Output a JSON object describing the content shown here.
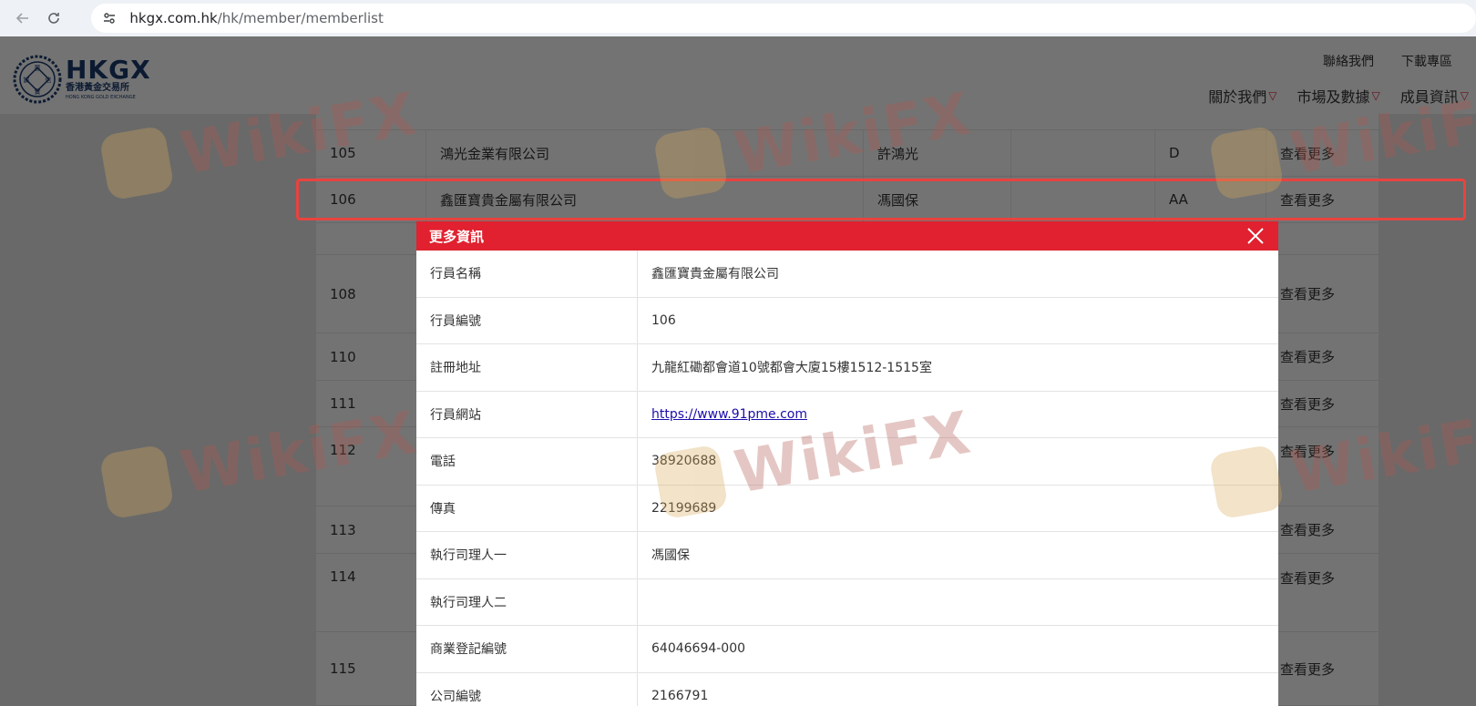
{
  "browser": {
    "url_host": "hkgx.com.hk",
    "url_path": "/hk/member/memberlist"
  },
  "site": {
    "logo_main": "HKGX",
    "logo_cn": "香港黃金交易所",
    "logo_en": "HONG KONG GOLD EXCHANGE",
    "seal_top": "蕙",
    "seal_left": "誠",
    "seal_right": "信",
    "seal_bottom": "實",
    "util_links": [
      "聯絡我們",
      "下載專區"
    ],
    "nav": [
      "關於我們",
      "市場及數據",
      "成員資訊"
    ]
  },
  "table": {
    "rows": [
      {
        "no": "105",
        "name": "鴻光金業有限公司",
        "rep": "許鴻光",
        "cat": "D",
        "more": "查看更多"
      },
      {
        "no": "106",
        "name": "鑫匯寶貴金屬有限公司",
        "rep": "馮國保",
        "cat": "AA",
        "more": "查看更多"
      },
      {
        "no": "108",
        "more": "查看更多"
      },
      {
        "no": "110",
        "more": "查看更多"
      },
      {
        "no": "111",
        "more": "查看更多"
      },
      {
        "no": "112",
        "more": "查看更多"
      },
      {
        "no": "113",
        "more": "查看更多"
      },
      {
        "no": "114",
        "more": "查看更多"
      },
      {
        "no": "115",
        "more": "查看更多"
      }
    ]
  },
  "modal": {
    "title": "更多資訊",
    "rows": [
      {
        "label": "行員名稱",
        "value": "鑫匯寶貴金屬有限公司"
      },
      {
        "label": "行員編號",
        "value": "106"
      },
      {
        "label": "註冊地址",
        "value": "九龍紅磡都會道10號都會大廈15樓1512-1515室"
      },
      {
        "label": "行員網站",
        "value": "https://www.91pme.com"
      },
      {
        "label": "電話",
        "value": "38920688"
      },
      {
        "label": "傳真",
        "value": "22199689"
      },
      {
        "label": "執行司理人一",
        "value": "馮國保"
      },
      {
        "label": "執行司理人二",
        "value": ""
      },
      {
        "label": "商業登記編號",
        "value": "64046694-000"
      },
      {
        "label": "公司編號",
        "value": "2166791"
      }
    ]
  },
  "watermark": {
    "text": "WikiFX"
  },
  "colors": {
    "accent_red": "#e1212f",
    "highlight_red": "#e8433f",
    "brand_navy": "#1a3a6e",
    "link_blue": "#1a0dab"
  }
}
